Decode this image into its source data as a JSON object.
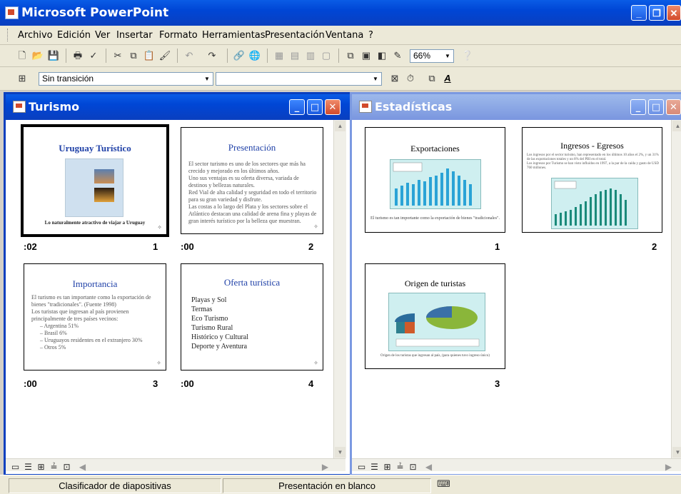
{
  "app": {
    "title": "Microsoft PowerPoint"
  },
  "menu": [
    "Archivo",
    "Edición",
    "Ver",
    "Insertar",
    "Formato",
    "Herramientas",
    "Presentación",
    "Ventana",
    "?"
  ],
  "toolbar": {
    "zoom": "66%"
  },
  "formatting": {
    "transition": "Sin transición",
    "design": ""
  },
  "windows": {
    "turismo": {
      "title": "Turismo",
      "slides": [
        {
          "title": "Uruguay Turístico",
          "footer": "Lo naturalmente atractivo de viajar a Uruguay",
          "timing": ":02",
          "number": "1"
        },
        {
          "title": "Presentación",
          "bullets": [
            "El sector turismo es uno de los sectores que más ha crecido y mejorado en los últimos años.",
            "Uno sus ventajas es su oferta diversa, variada de destinos y bellezas naturales.",
            "Red Vial de alta calidad y seguridad en todo el territorio para su gran variedad y disfrute.",
            "Las costas a lo largo del Plata y los sectores sobre el Atlántico destacan una calidad de arena fina y playas de gran interés turístico por la belleza que muestran."
          ],
          "timing": ":00",
          "number": "2"
        },
        {
          "title": "Importancia",
          "bullets": [
            "El turismo es tan importante como la exportación de bienes \"tradicionales\". (Fuente 1998)",
            "Los turistas que ingresan al país provienen principalmente de tres países vecinos:"
          ],
          "subbullets": [
            "– Argentina 51%",
            "– Brasil 6%",
            "– Uruguayos residentes en el extranjero 30%",
            "– Otros 5%"
          ],
          "timing": ":00",
          "number": "3"
        },
        {
          "title": "Oferta turística",
          "bullets": [
            "Playas y Sol",
            "Termas",
            "Eco Turismo",
            "Turismo Rural",
            "Histórico y Cultural",
            "Deporte y Aventura"
          ],
          "timing": ":00",
          "number": "4"
        }
      ]
    },
    "estadisticas": {
      "title": "Estadísticas",
      "slides": [
        {
          "title": "Exportaciones",
          "caption": "El turismo es tan importante como la exportación de bienes \"tradicionales\".",
          "number": "1"
        },
        {
          "title": "Ingresos - Egresos",
          "bullets": [
            "Los ingresos por el sector turismo, han representado en los últimos 10 años el 2%, y un 31% de las exportaciones totales y un 8% del PBI en el total.",
            "Los ingresos por Turismo se han visto influidos en 1997, a la par de la caída y gasto de USD 760 millones."
          ],
          "number": "2"
        },
        {
          "title": "Origen de turistas",
          "caption": "Origen de los turistas que ingresan al país, (para quienes tuvo ingreso único)",
          "number": "3"
        }
      ]
    }
  },
  "status": {
    "view": "Clasificador de diapositivas",
    "design": "Presentación en blanco"
  }
}
